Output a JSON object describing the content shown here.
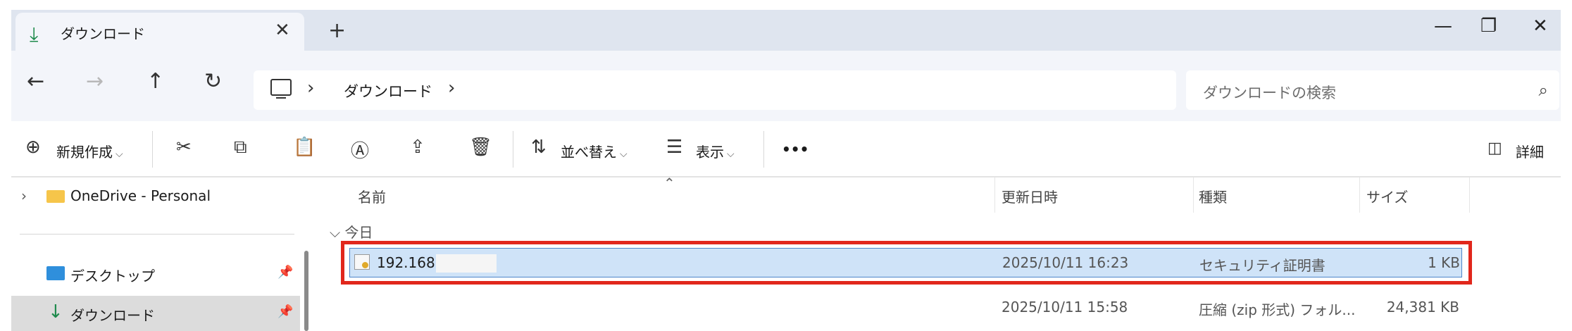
{
  "tab": {
    "icon": "download-icon",
    "title": "ダウンロード",
    "close": "✕",
    "new": "+"
  },
  "window_controls": {
    "minimize": "—",
    "restore": "❐",
    "close": "✕"
  },
  "nav": {
    "back": "←",
    "forward": "→",
    "up": "↑",
    "refresh": "↻"
  },
  "address": {
    "sep1": "›",
    "crumb": "ダウンロード",
    "sep2": "›"
  },
  "search": {
    "placeholder": "ダウンロードの検索",
    "icon": "⌕"
  },
  "toolbar": {
    "new_icon": "⊕",
    "new_label": "新規作成",
    "new_chev": "⌵",
    "sort_label": "並べ替え",
    "sort_chev": "⌵",
    "view_label": "表示",
    "view_chev": "⌵",
    "more": "•••",
    "details_label": "詳細"
  },
  "sidebar": {
    "items": [
      {
        "label": "OneDrive - Personal",
        "expander": "›"
      },
      {
        "label": "デスクトップ",
        "pin": "📌"
      },
      {
        "label": "ダウンロード",
        "pin": "📌",
        "icon": "↓"
      }
    ]
  },
  "columns": {
    "name": "名前",
    "modified": "更新日時",
    "type": "種類",
    "size": "サイズ",
    "sort_caret": "⌃"
  },
  "group": {
    "label": "⌵ 今日"
  },
  "files": [
    {
      "name": "192.168.",
      "modified": "2025/10/11 16:23",
      "type": "セキュリティ証明書",
      "size": "1 KB"
    },
    {
      "name": "",
      "modified": "2025/10/11 15:58",
      "type": "圧縮 (zip 形式) フォル...",
      "size": "24,381 KB"
    }
  ]
}
